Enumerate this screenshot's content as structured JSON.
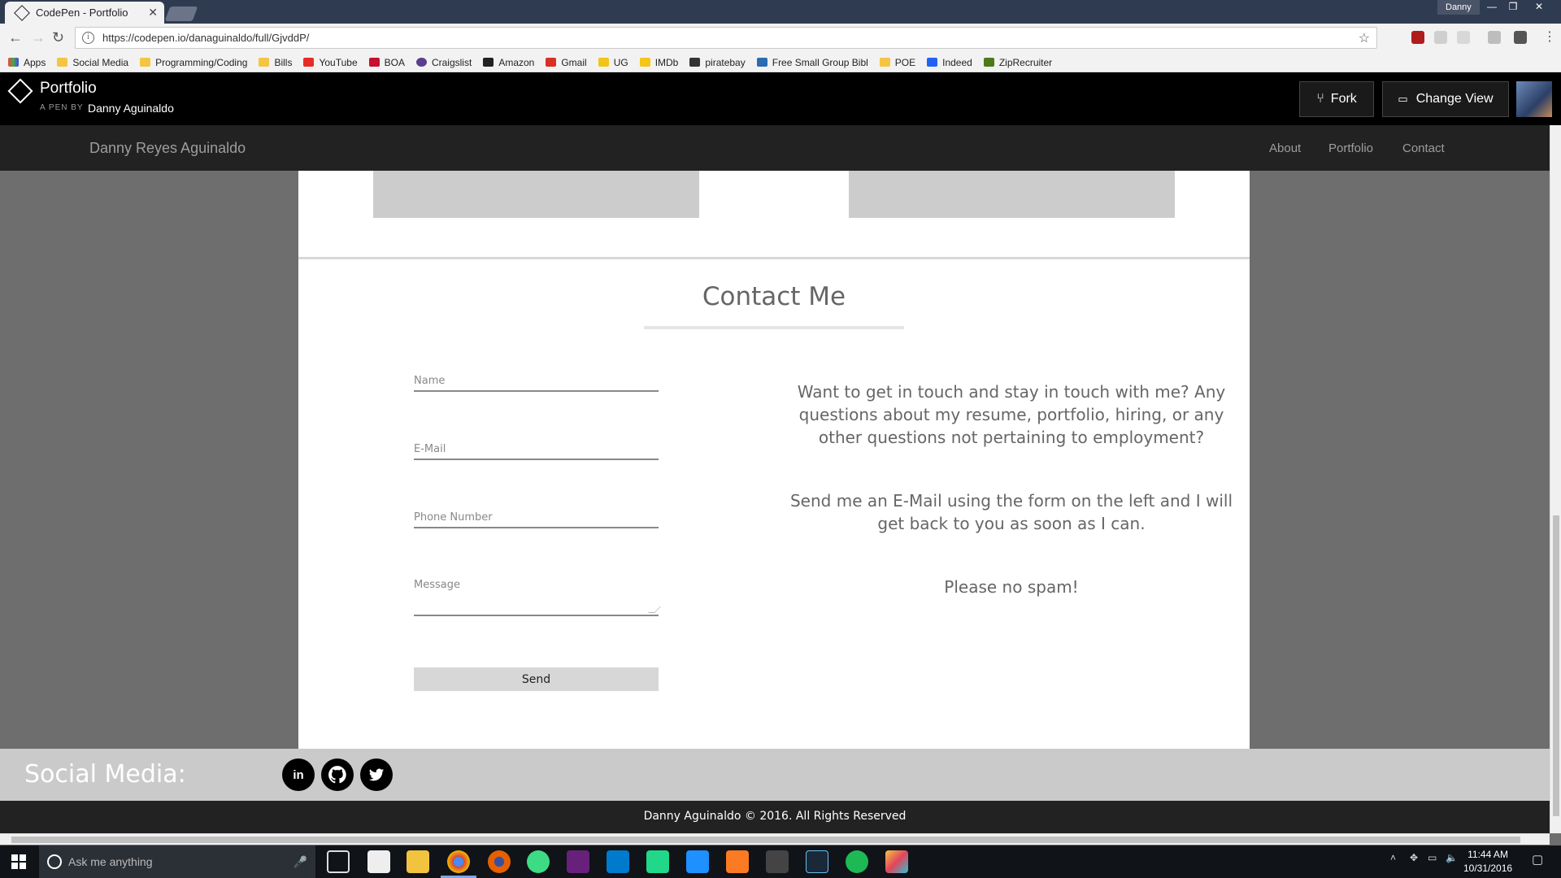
{
  "browser": {
    "tab_title": "CodePen - Portfolio",
    "user_name": "Danny",
    "url": "https://codepen.io/danaguinaldo/full/GjvddP/",
    "bookmarks": [
      "Apps",
      "Social Media",
      "Programming/Coding",
      "Bills",
      "YouTube",
      "BOA",
      "Craigslist",
      "Amazon",
      "Gmail",
      "UG",
      "IMDb",
      "piratebay",
      "Free Small Group Bibl",
      "POE",
      "Indeed",
      "ZipRecruiter"
    ]
  },
  "codepen": {
    "pen_title": "Portfolio",
    "by_label": "A PEN BY",
    "author": "Danny Aguinaldo",
    "fork_label": "Fork",
    "change_view_label": "Change View"
  },
  "site": {
    "brand": "Danny Reyes Aguinaldo",
    "nav": [
      "About",
      "Portfolio",
      "Contact"
    ],
    "contact_title": "Contact Me",
    "form": {
      "name_placeholder": "Name",
      "email_placeholder": "E-Mail",
      "phone_placeholder": "Phone Number",
      "message_placeholder": "Message",
      "send_label": "Send"
    },
    "messages": [
      "Want to get in touch and stay in touch with me? Any questions about my resume, portfolio, hiring, or any other questions not pertaining to employment?",
      "Send me an E-Mail using the form on the left and I will get back to you as soon as I can.",
      "Please no spam!"
    ],
    "social_title": "Social Media:",
    "social_icons": [
      "linkedin-icon",
      "github-icon",
      "twitter-icon"
    ],
    "footer": "Danny Aguinaldo © 2016. All Rights Reserved"
  },
  "taskbar": {
    "search_placeholder": "Ask me anything",
    "time": "11:44 AM",
    "date": "10/31/2016"
  },
  "colors": {
    "page_bg": "#6e6e6e",
    "navbar": "#222222",
    "panel": "#ffffff",
    "social_bar": "#cacaca",
    "accent_text": "#666666"
  }
}
